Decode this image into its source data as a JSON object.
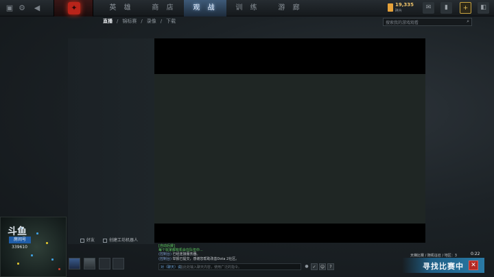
{
  "topbar": {
    "left_icons": [
      "dota-menu-icon",
      "gear-icon",
      "back-arrow-icon"
    ],
    "nav": [
      {
        "label": "英 雄",
        "active": false
      },
      {
        "label": "商 店",
        "active": false
      },
      {
        "label": "观 战",
        "active": true
      },
      {
        "label": "训 练",
        "active": false
      },
      {
        "label": "游 廊",
        "active": false
      }
    ],
    "coins": {
      "value": "19,335",
      "sub": "碎片"
    },
    "right_icons": [
      "mail-icon",
      "inventory-icon",
      "settings-icon",
      "plus-icon"
    ]
  },
  "subnav": {
    "items": [
      {
        "label": "直播",
        "active": true
      },
      {
        "label": "/",
        "active": false
      },
      {
        "label": "锦标赛",
        "active": false
      },
      {
        "label": "/",
        "active": false
      },
      {
        "label": "录像",
        "active": false
      },
      {
        "label": "/",
        "active": false
      },
      {
        "label": "下载",
        "active": false
      }
    ]
  },
  "search": {
    "placeholder": "搜索我的游戏观看"
  },
  "filters": {
    "friends": "好友",
    "create_bot": "创建工坊机器人"
  },
  "stream_overlay": {
    "logo": "斗鱼",
    "room_label": "房间号",
    "room_number": "339610"
  },
  "chat": {
    "lines": [
      {
        "tag": "",
        "text": "[自动后援]",
        "color": "g"
      },
      {
        "tag": "",
        "text": "每个玩家都有机会在队伍中...",
        "color": "g"
      },
      {
        "tag": "(控制台)",
        "text": "已经连接服务器。",
        "color": "w"
      },
      {
        "tag": "(控制台)",
        "text": "举报已提交，感谢您帮助改善Dota 2社区。",
        "color": "w"
      }
    ],
    "input_prefix": "对（聊天）说:",
    "input_placeholder": "在此处输入聊天内容，使用广泛的指令。"
  },
  "matchmaking": {
    "status": "天梯比赛 / 随机征召 / 地区：3",
    "time": "0:22",
    "find_label": "寻找比赛中",
    "cancel": "✕"
  }
}
